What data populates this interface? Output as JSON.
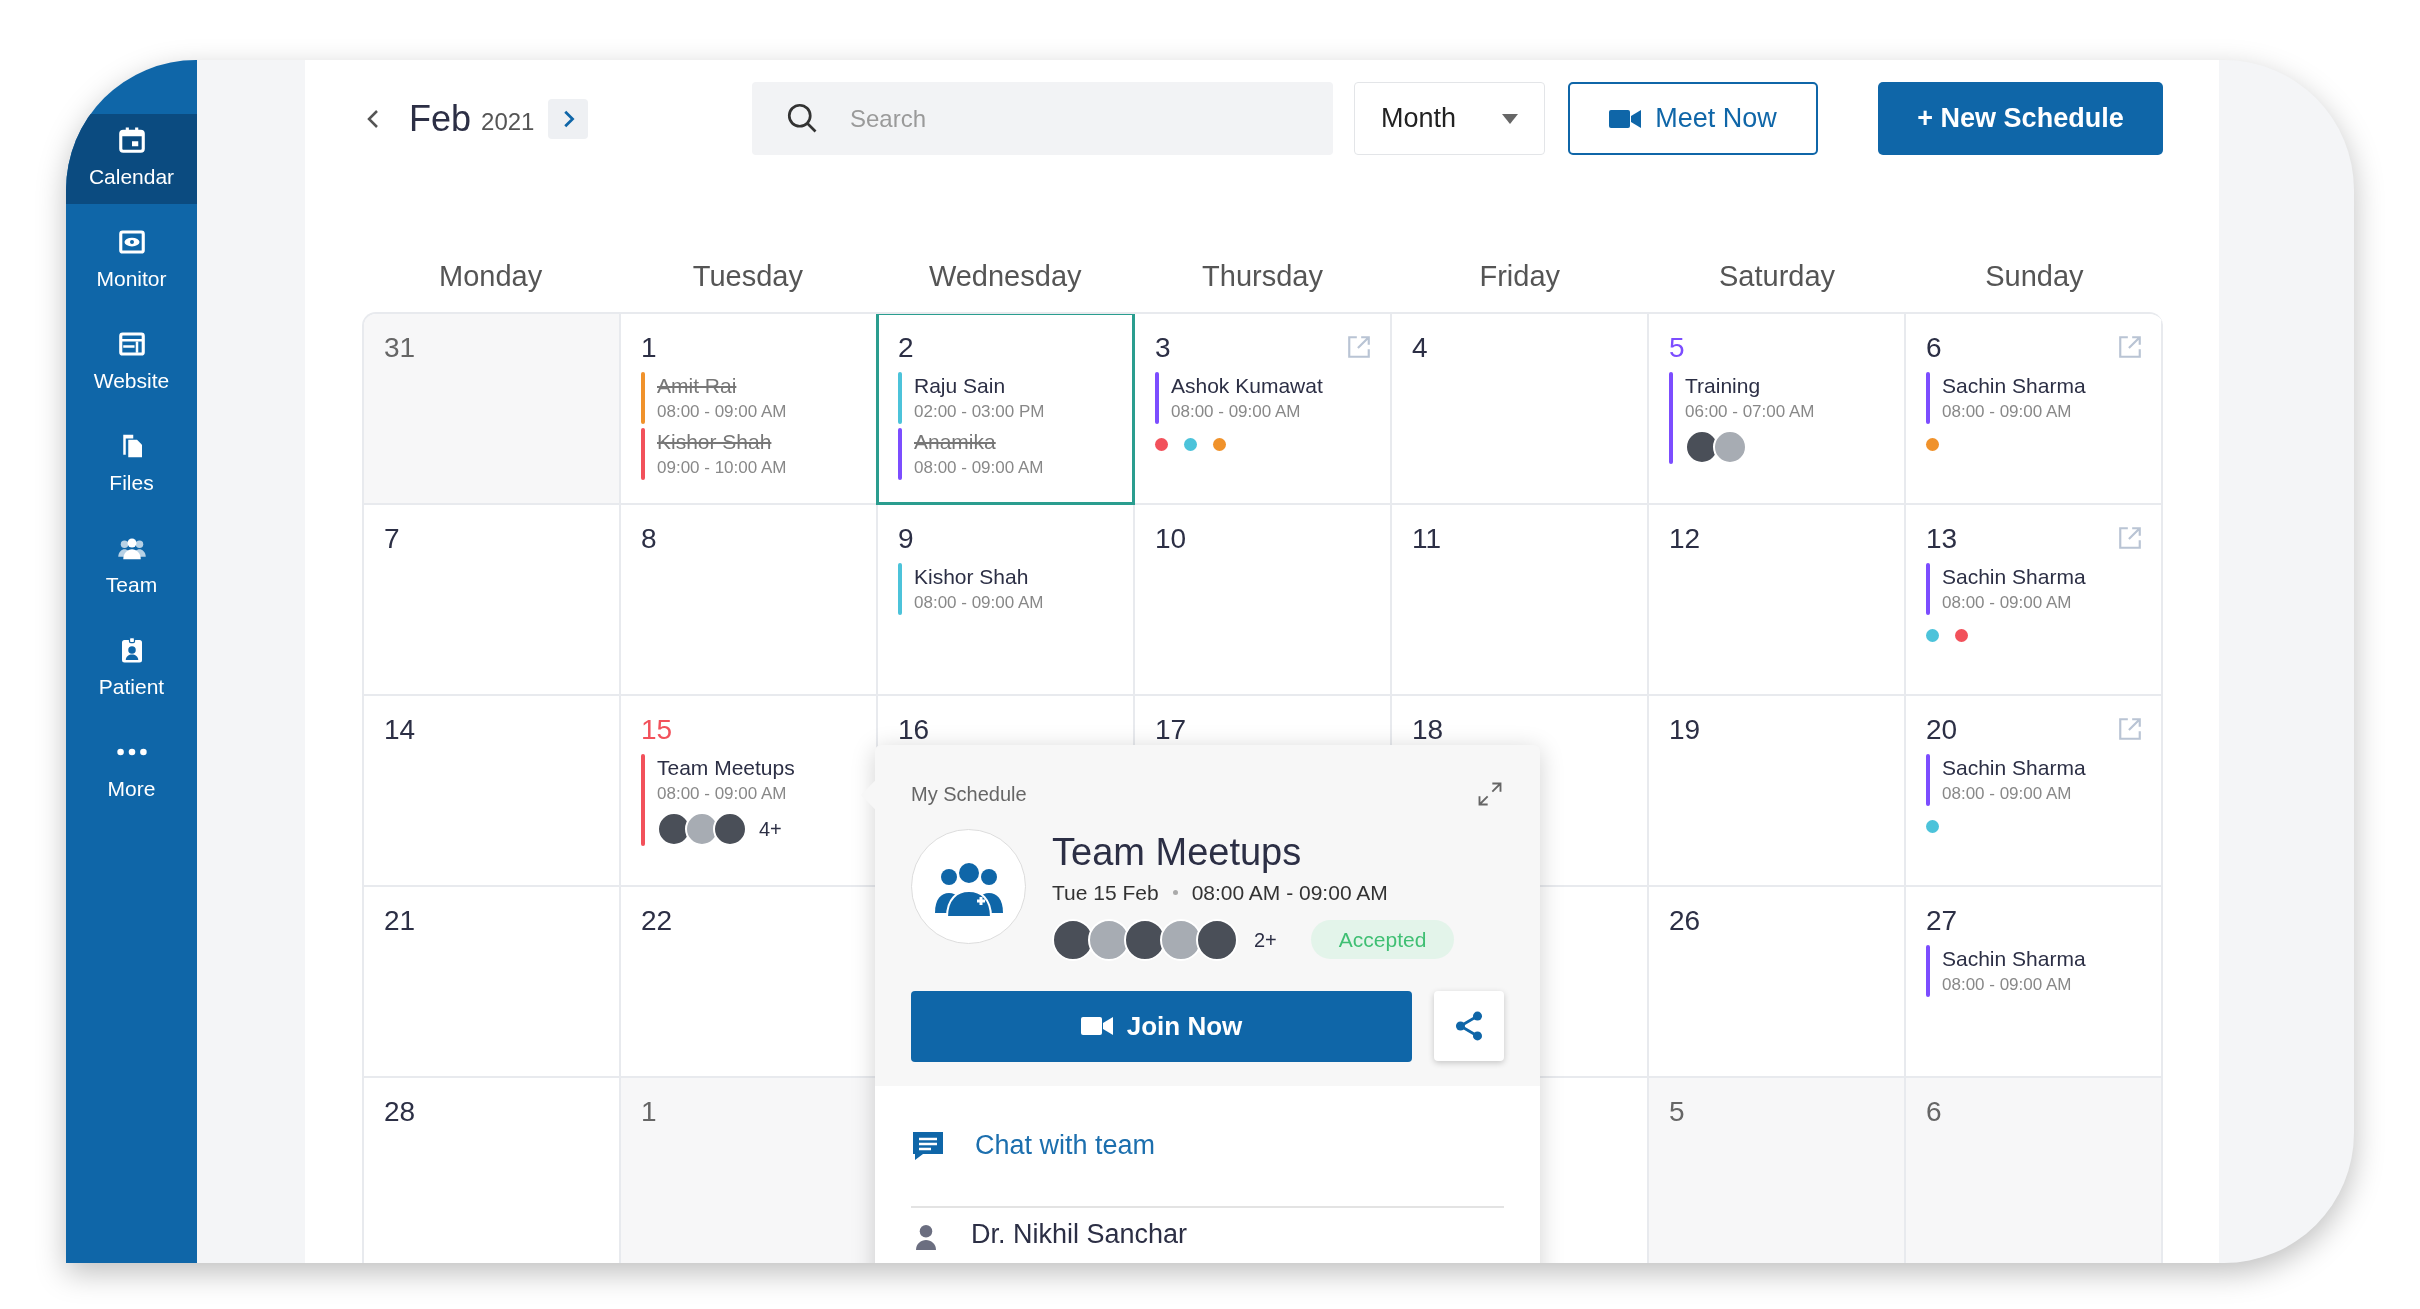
{
  "sidebar": {
    "items": [
      {
        "label": "Calendar",
        "selected": true
      },
      {
        "label": "Monitor",
        "selected": false
      },
      {
        "label": "Website",
        "selected": false
      },
      {
        "label": "Files",
        "selected": false
      },
      {
        "label": "Team",
        "selected": false
      },
      {
        "label": "Patient",
        "selected": false
      },
      {
        "label": "More",
        "selected": false
      }
    ]
  },
  "toolbar": {
    "month": "Feb",
    "year": "2021",
    "search": {
      "placeholder": "Search"
    },
    "view": "Month",
    "meet_button": "Meet Now",
    "new_button": "+ New Schedule"
  },
  "weekdays": [
    "Monday",
    "Tuesday",
    "Wednesday",
    "Thursday",
    "Friday",
    "Saturday",
    "Sunday"
  ],
  "weeks": [
    [
      {
        "day": "31",
        "other_month": true
      },
      {
        "day": "1",
        "events": [
          {
            "name": "Amit Rai",
            "time": "08:00 - 09:00 AM",
            "color": "#f0922b",
            "cancelled": true
          },
          {
            "name": "Kishor Shah",
            "time": "09:00 - 10:00 AM",
            "color": "#f2515b",
            "cancelled": true
          }
        ]
      },
      {
        "day": "2",
        "selected": true,
        "events": [
          {
            "name": "Raju Sain",
            "time": "02:00 - 03:00 PM",
            "color": "#4cc3da",
            "cancelled": false
          },
          {
            "name": "Anamika",
            "time": "08:00 - 09:00 AM",
            "color": "#7c4dff",
            "cancelled": true
          }
        ]
      },
      {
        "day": "3",
        "link": true,
        "events": [
          {
            "name": "Ashok Kumawat",
            "time": "08:00 - 09:00 AM",
            "color": "#7c4dff",
            "cancelled": false
          }
        ],
        "dots": [
          {
            "color": "#f2515b"
          },
          {
            "color": "#4cc3da"
          },
          {
            "color": "#f0922b"
          }
        ]
      },
      {
        "day": "4"
      },
      {
        "day": "5",
        "color": "#7c4dff",
        "events": [
          {
            "name": "Training",
            "time": "06:00 - 07:00 AM",
            "color": "#7c4dff",
            "cancelled": false,
            "avatars": [
              {
                "kind": "photo"
              },
              {
                "kind": "photo"
              }
            ]
          }
        ]
      },
      {
        "day": "6",
        "link": true,
        "events": [
          {
            "name": "Sachin Sharma",
            "time": "08:00 - 09:00 AM",
            "color": "#7c4dff",
            "cancelled": false
          }
        ],
        "dots": [
          {
            "color": "#f0922b"
          }
        ]
      }
    ],
    [
      {
        "day": "7"
      },
      {
        "day": "8"
      },
      {
        "day": "9",
        "events": [
          {
            "name": "Kishor Shah",
            "time": "08:00 - 09:00 AM",
            "color": "#4cc3da",
            "cancelled": false
          }
        ]
      },
      {
        "day": "10"
      },
      {
        "day": "11"
      },
      {
        "day": "12"
      },
      {
        "day": "13",
        "link": true,
        "events": [
          {
            "name": "Sachin Sharma",
            "time": "08:00 - 09:00 AM",
            "color": "#7c4dff",
            "cancelled": false
          }
        ],
        "dots": [
          {
            "color": "#4cc3da"
          },
          {
            "color": "#f2515b"
          }
        ]
      }
    ],
    [
      {
        "day": "14"
      },
      {
        "day": "15",
        "color": "#f2515b",
        "events": [
          {
            "name": "Team Meetups",
            "time": "08:00 - 09:00 AM",
            "color": "#f2515b",
            "cancelled": false,
            "avatars": [
              {
                "kind": "photo"
              },
              {
                "kind": "photo"
              },
              {
                "kind": "photo"
              }
            ],
            "extra": "4+"
          }
        ]
      },
      {
        "day": "16"
      },
      {
        "day": "17"
      },
      {
        "day": "18"
      },
      {
        "day": "19"
      },
      {
        "day": "20",
        "link": true,
        "events": [
          {
            "name": "Sachin Sharma",
            "time": "08:00 - 09:00 AM",
            "color": "#7c4dff",
            "cancelled": false
          }
        ],
        "dots": [
          {
            "color": "#4cc3da"
          }
        ]
      }
    ],
    [
      {
        "day": "21"
      },
      {
        "day": "22"
      },
      {
        "day": "26"
      },
      {
        "day": "27",
        "events": [
          {
            "name": "Sachin Sharma",
            "time": "08:00 - 09:00 AM",
            "color": "#7c4dff",
            "cancelled": false
          }
        ]
      }
    ],
    [
      {
        "day": "28"
      },
      {
        "day": "1",
        "other_month": true
      },
      {
        "day": "5",
        "other_month": true
      },
      {
        "day": "6",
        "other_month": true
      }
    ]
  ],
  "popup": {
    "heading": "My Schedule",
    "title": "Team Meetups",
    "date": "Tue 15 Feb",
    "time": "08:00 AM - 09:00 AM",
    "avatars": [
      {
        "kind": "photo"
      },
      {
        "kind": "photo"
      },
      {
        "kind": "photo"
      },
      {
        "kind": "photo"
      },
      {
        "kind": "photo"
      }
    ],
    "extra": "2+",
    "status": "Accepted",
    "join_button": "Join Now",
    "chat_link": "Chat with team",
    "organizer": "Dr. Nikhil Sanchar"
  }
}
